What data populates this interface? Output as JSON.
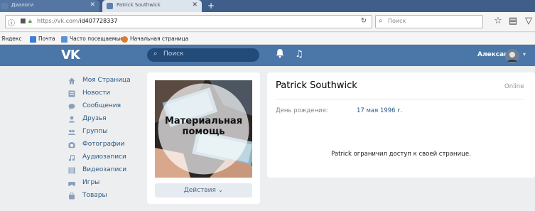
{
  "browser": {
    "tabs": [
      {
        "title": "Диалоги",
        "active": false
      },
      {
        "title": "Patrick Southwick",
        "active": true
      }
    ],
    "new_tab": "+",
    "url_host": "https://vk.com/",
    "url_path": "id407728337",
    "search_placeholder": "Поиск",
    "bookmarks": [
      {
        "label": "Яндекс",
        "icon": "none"
      },
      {
        "label": "Почта",
        "icon": "mail-icon"
      },
      {
        "label": "Часто посещаемые",
        "icon": "folder-icon"
      },
      {
        "label": "Начальная страница",
        "icon": "firefox-icon"
      }
    ]
  },
  "vk_header": {
    "logo": "VK",
    "search_placeholder": "Поиск",
    "user_name": "Александр"
  },
  "left_menu": [
    {
      "label": "Моя Страница",
      "icon": "home-icon"
    },
    {
      "label": "Новости",
      "icon": "news-icon"
    },
    {
      "label": "Сообщения",
      "icon": "messages-icon"
    },
    {
      "label": "Друзья",
      "icon": "friend-icon"
    },
    {
      "label": "Группы",
      "icon": "groups-icon"
    },
    {
      "label": "Фотографии",
      "icon": "camera-icon"
    },
    {
      "label": "Аудиозаписи",
      "icon": "music-note-icon"
    },
    {
      "label": "Видеозаписи",
      "icon": "film-icon"
    },
    {
      "label": "Игры",
      "icon": "gamepad-icon"
    },
    {
      "label": "Товары",
      "icon": "bag-icon"
    }
  ],
  "profile": {
    "photo_caption": "Материальная помощь",
    "actions_label": "Действия",
    "name": "Patrick Southwick",
    "status": "Online",
    "birthday_label": "День рождения:",
    "birthday_value": "17 мая 1996 г.",
    "restricted_text": "Patrick ограничил доступ к своей странице."
  },
  "colors": {
    "vk_blue": "#4a76a8",
    "link": "#2a5885",
    "page_bg": "#edeef0"
  }
}
